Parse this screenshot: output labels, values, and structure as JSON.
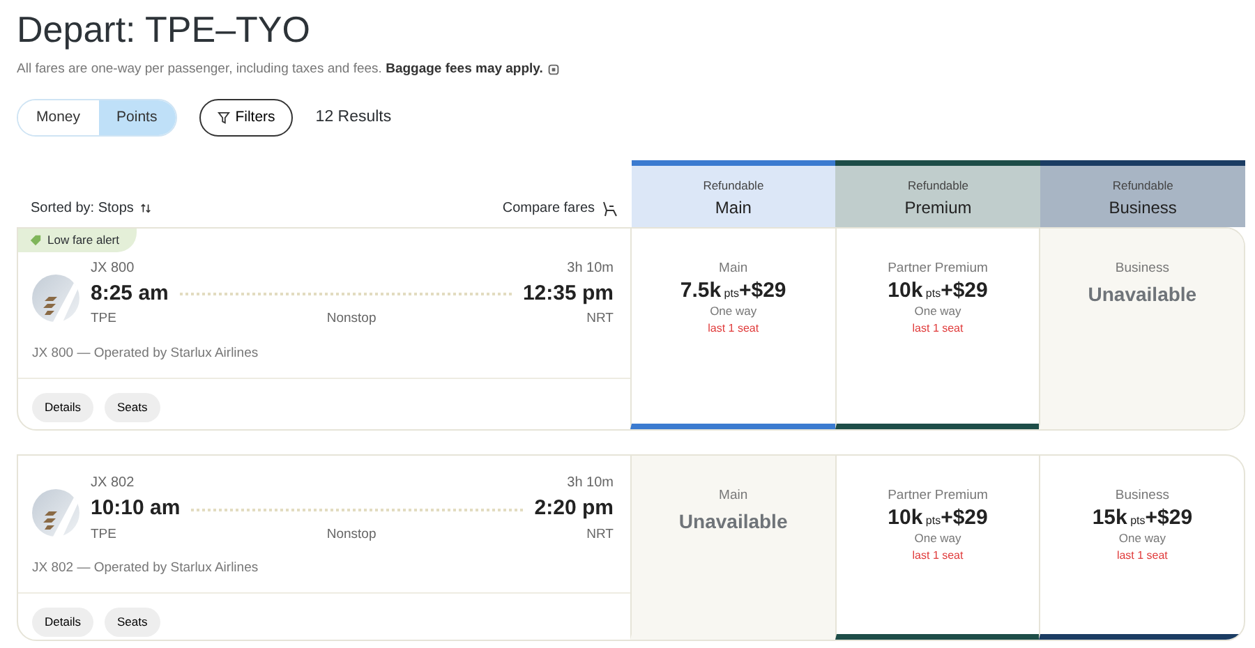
{
  "title": "Depart: TPE–TYO",
  "notice": {
    "text": "All fares are one-way per passenger, including taxes and fees.",
    "emphasis": "Baggage fees may apply."
  },
  "view_toggle": [
    {
      "label": "Money",
      "selected": false
    },
    {
      "label": "Points",
      "selected": true
    }
  ],
  "filters_button": "Filters",
  "results_count": "12 Results",
  "sort_label": "Sorted by: Stops",
  "compare_label": "Compare fares",
  "cabins": [
    {
      "tag": "Refundable",
      "name": "Main",
      "color": "#3b7bd0"
    },
    {
      "tag": "Refundable",
      "name": "Premium",
      "color": "#1e4d48"
    },
    {
      "tag": "Refundable",
      "name": "Business",
      "color": "#1b3c63"
    }
  ],
  "flights": [
    {
      "alert": "Low fare alert",
      "flight_no": "JX 800",
      "duration": "3h 10m",
      "depart_time": "8:25 am",
      "arrive_time": "12:35 pm",
      "origin": "TPE",
      "stops": "Nonstop",
      "destination": "NRT",
      "operator": "JX 800 — Operated by Starlux Airlines",
      "actions": [
        "Details",
        "Seats"
      ],
      "fares": [
        {
          "kind": "available",
          "fare_name": "Main",
          "points": "7.5k",
          "unit": "pts",
          "cash": "+$29",
          "trip": "One way",
          "seats": "last 1 seat"
        },
        {
          "kind": "available",
          "fare_name": "Partner Premium",
          "points": "10k",
          "unit": "pts",
          "cash": "+$29",
          "trip": "One way",
          "seats": "last 1 seat"
        },
        {
          "kind": "unavailable",
          "fare_name": "Business",
          "status": "Unavailable"
        }
      ]
    },
    {
      "flight_no": "JX 802",
      "duration": "3h 10m",
      "depart_time": "10:10 am",
      "arrive_time": "2:20 pm",
      "origin": "TPE",
      "stops": "Nonstop",
      "destination": "NRT",
      "operator": "JX 802 — Operated by Starlux Airlines",
      "actions": [
        "Details",
        "Seats"
      ],
      "fares": [
        {
          "kind": "unavailable",
          "fare_name": "Main",
          "status": "Unavailable"
        },
        {
          "kind": "available",
          "fare_name": "Partner Premium",
          "points": "10k",
          "unit": "pts",
          "cash": "+$29",
          "trip": "One way",
          "seats": "last 1 seat"
        },
        {
          "kind": "available",
          "fare_name": "Business",
          "points": "15k",
          "unit": "pts",
          "cash": "+$29",
          "trip": "One way",
          "seats": "last 1 seat"
        }
      ]
    }
  ]
}
